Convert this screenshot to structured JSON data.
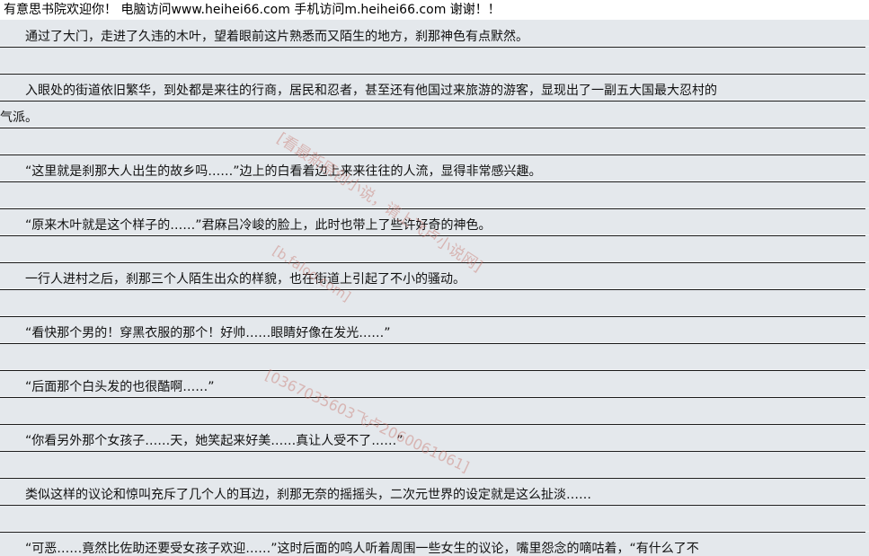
{
  "banner": {
    "text": "有意思书院欢迎你！  电脑访问www.heihei66.com    手机访问m.heihei66.com  谢谢！！"
  },
  "paragraphs": [
    "　　通过了大门，走进了久违的木叶，望着眼前这片熟悉而又陌生的地方，刹那神色有点默然。",
    "",
    "　　入眼处的街道依旧繁华，到处都是来往的行商，居民和忍者，甚至还有他国过来旅游的游客，显现出了一副五大国最大忍村的",
    "气派。",
    "",
    "　　“这里就是刹那大人出生的故乡吗……”边上的白看着边上来来往往的人流，显得非常感兴趣。",
    "",
    "　　“原来木叶就是这个样子的……”君麻吕冷峻的脸上，此时也带上了些许好奇的神色。",
    "",
    "　　一行人进村之后，刹那三个人陌生出众的样貌，也在街道上引起了不小的骚动。",
    "",
    "　　“看快那个男的！穿黑衣服的那个！好帅……眼睛好像在发光……”",
    "",
    "　　“后面那个白头发的也很酷啊……”",
    "",
    "　　“你看另外那个女孩子……天，她笑起来好美……真让人受不了……”",
    "",
    "　　类似这样的议论和惊叫充斥了几个人的耳边，刹那无奈的摇摇头，二次元世界的设定就是这么扯淡……",
    "",
    "　　“可恶……竟然比佐助还要受女孩子欢迎……”这时后面的鸣人听着周围一些女生的议论，嘴里怨念的嘀咕着，“有什么了不"
  ],
  "watermark": {
    "line1": "[看最新原创小说，请上飞卢小说网]",
    "line2": "[b.faloo.com]",
    "line3": "[0367035603飞卢2060061061]"
  }
}
